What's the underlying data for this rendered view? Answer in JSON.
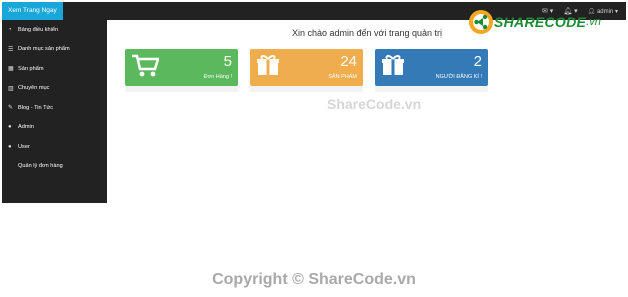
{
  "header": {
    "view_site_label": "Xem Trang Ngay",
    "mail_icon": "envelope-icon",
    "bell_icon": "bell-icon",
    "user_icon": "user-icon",
    "user_label": "admin"
  },
  "sidebar": {
    "items": [
      {
        "icon": "dashboard-icon",
        "label": "Bảng điều khiển"
      },
      {
        "icon": "list-icon",
        "label": "Danh mục sản phẩm"
      },
      {
        "icon": "table-icon",
        "label": "Sản phẩm"
      },
      {
        "icon": "chart-icon",
        "label": "Chuyên mục"
      },
      {
        "icon": "edit-icon",
        "label": "Blog - Tin Tức"
      },
      {
        "icon": "user-icon",
        "label": "Admin"
      },
      {
        "icon": "user-icon",
        "label": "User"
      },
      {
        "icon": "",
        "label": "Quản lý đơn hàng"
      }
    ]
  },
  "main": {
    "title": "Xin chào admin đến với trang quản trị",
    "cards": [
      {
        "count": "5",
        "label": "Đơn Hàng !",
        "icon": "shopping-cart-icon",
        "color": "#5cb85c"
      },
      {
        "count": "24",
        "label": "SẢN PHẨM",
        "icon": "gift-icon",
        "color": "#f0ad4e"
      },
      {
        "count": "2",
        "label": "NGƯỜI ĐĂNG KÍ !",
        "icon": "gift-icon",
        "color": "#337ab7"
      }
    ]
  },
  "watermark": {
    "logo_text": "SHARECODE",
    "logo_suffix": ".vn",
    "center_text": "ShareCode.vn",
    "copyright": "Copyright © ShareCode.vn"
  }
}
